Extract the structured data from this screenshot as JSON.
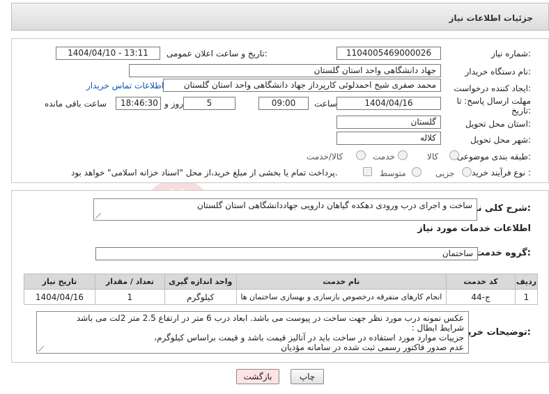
{
  "header": {
    "title": "جزئیات اطلاعات نیاز"
  },
  "form": {
    "need_number": {
      "label": "شماره نیاز:",
      "value": "1104005469000026"
    },
    "announce_datetime": {
      "label": "تاریخ و ساعت اعلان عمومی:",
      "value": "1404/04/10 - 13:11"
    },
    "buyer_org": {
      "label": "نام دستگاه خریدار:",
      "value": "جهاد دانشگاهی واحد استان گلستان"
    },
    "requester": {
      "label": "ایجاد کننده درخواست:",
      "value": "محمد صفری شیخ احمدلوئی کارپرداز جهاد دانشگاهی واحد استان گلستان"
    },
    "contact_link": "اطلاعات تماس خریدار",
    "deadline": {
      "label_line1": "مهلت ارسال پاسخ: تا",
      "label_line2": "تاریخ:",
      "date": "1404/04/16",
      "time_label": "ساعت",
      "time": "09:00",
      "days": "5",
      "days_label": "روز و",
      "remaining": "18:46:30",
      "remaining_label": "ساعت باقی مانده"
    },
    "province": {
      "label": "استان محل تحویل:",
      "value": "گلستان"
    },
    "city": {
      "label": "شهر محل تحویل:",
      "value": "کلاله"
    },
    "category": {
      "label": "طبقه بندی موضوعی:",
      "options": [
        "کالا",
        "خدمت",
        "کالا/خدمت"
      ],
      "selected": "خدمت"
    },
    "process": {
      "label": "نوع فرآیند خرید :",
      "options": [
        "جزیی",
        "متوسط"
      ],
      "selected": "جزیی",
      "payment_note": "پرداخت تمام یا بخشی از مبلغ خرید،از محل \"اسناد خزانه اسلامی\" خواهد بود."
    }
  },
  "summary": {
    "label": "شرح کلی نیاز:",
    "value": "ساخت و اجرای درب ورودی دهکده گیاهان دارویی جهاددانشگاهی استان گلستان"
  },
  "services_title": "اطلاعات خدمات مورد نیاز",
  "service_group": {
    "label": "گروه خدمت:",
    "value": "ساختمان"
  },
  "table": {
    "headers": [
      "ردیف",
      "کد خدمت",
      "نام خدمت",
      "واحد اندازه گیری",
      "تعداد / مقدار",
      "تاریخ نیاز"
    ],
    "rows": [
      [
        "1",
        "ج-44",
        "انجام کارهای متفرقه درخصوص بازسازی و بهسازی ساختمان ها",
        "کیلوگرم",
        "1",
        "1404/04/16"
      ]
    ]
  },
  "buyer_notes": {
    "label": "توضیحات خریدار:",
    "lines": [
      "عکس نمونه درب مورد نظر جهت ساخت در پیوست می باشد. ابعاد درب 6 متر در ارتفاع 2.5 متر 2لت می باشد",
      "شرایط ابطال :",
      "جزییات موارد مورد استفاده در ساخت باید در آنالیز قیمت باشد و قیمت براساس کیلوگرم،",
      "عدم صدور فاکتور رسمی ثبت شده در سامانه مؤدیان"
    ]
  },
  "buttons": {
    "print": "چاپ",
    "back": "بازگشت"
  },
  "watermark_text": "AriaTender.neT",
  "colors": {
    "link": "#0b57b5",
    "header_bg": "#dcdcdc",
    "table_header": "#d9d9d9",
    "back_button": "#fde3e3"
  }
}
